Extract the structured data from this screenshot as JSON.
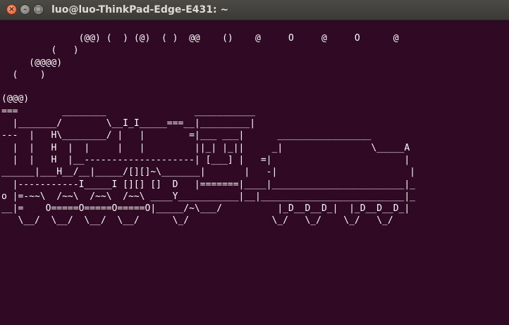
{
  "window": {
    "title": "luo@luo-ThinkPad-Edge-E431: ~",
    "buttons": {
      "close": "×",
      "minimize": "–",
      "maximize": "□"
    }
  },
  "terminal": {
    "lines": [
      "              (@@) (  ) (@)  ( )  @@    ()    @     O     @     O      @",
      "         (   )",
      "     (@@@@)",
      "  (    )",
      "",
      "(@@@)",
      "===        ________                ___________",
      "  |_______/        \\__I_I_____===__|_________|",
      "---  |   H\\________/ |   |        =|___ ___|      _________________",
      "  |  |   H  |  |     |   |         ||_| |_||     _|                \\_____A",
      "  |  |   H  |__--------------------| [___] |   =|                        |",
      "______|___H__/__|_____/[][]~\\_______|       |   -|                        |",
      "  |-----------I_____I [][] []  D   |=======|____|________________________|_",
      "o |=-~~\\  /~~\\  /~~\\  /~~\\ ____Y___________|__|__________________________|_",
      "__|=    O=====O=====O=====O|_____/~\\___/          |_D__D__D_|  |_D__D__D_|",
      "   \\__/  \\__/  \\__/  \\__/      \\_/               \\_/   \\_/    \\_/   \\_/"
    ]
  }
}
